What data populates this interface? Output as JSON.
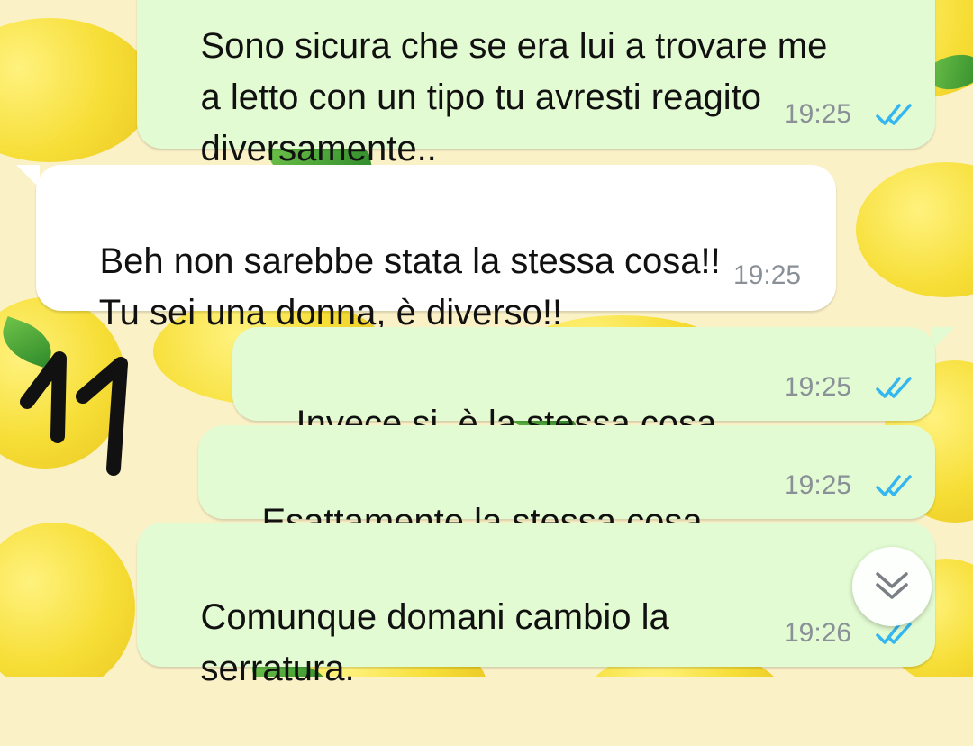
{
  "messages": [
    {
      "direction": "outgoing",
      "lines": [
        "Sono sicura che se era lui a trovare me",
        "a letto con un tipo tu avresti reagito",
        "diversamente.."
      ],
      "time": "19:25",
      "status": "read"
    },
    {
      "direction": "incoming",
      "lines": [
        "Beh non sarebbe stata la stessa cosa!!",
        "Tu sei una donna, è diverso!!"
      ],
      "time": "19:25"
    },
    {
      "direction": "outgoing",
      "lines": [
        "Invece si, è la stessa cosa."
      ],
      "time": "19:25",
      "status": "read"
    },
    {
      "direction": "outgoing",
      "lines": [
        "Esattamente la stessa cosa."
      ],
      "time": "19:25",
      "status": "read"
    },
    {
      "direction": "outgoing",
      "lines": [
        "Comunque domani cambio la",
        "serratura."
      ],
      "time": "19:26",
      "status": "read"
    }
  ],
  "overlay_number": "11",
  "icons": {
    "read_receipt": "double-check-icon",
    "scroll_down": "chevron-double-down-icon"
  },
  "colors": {
    "outgoing_bubble": "#e3fbd2",
    "incoming_bubble": "#ffffff",
    "read_ticks": "#34b7f1",
    "timestamp": "#8a9097",
    "wallpaper": "#fbf1c6"
  }
}
